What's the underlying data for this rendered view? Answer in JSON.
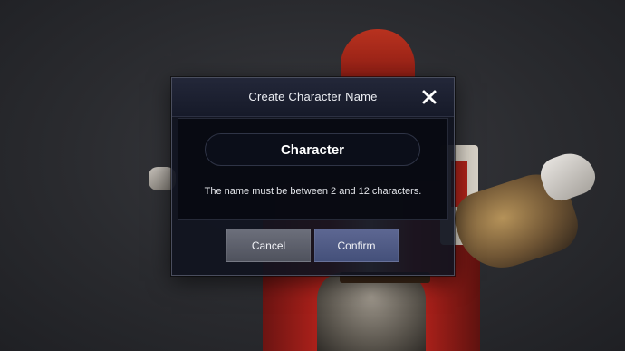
{
  "dialog": {
    "title": "Create Character Name",
    "close_icon": "close-icon",
    "name_input": {
      "value": "Character",
      "placeholder": ""
    },
    "hint": "The name must be between 2 and 12 characters.",
    "cancel_label": "Cancel",
    "confirm_label": "Confirm"
  },
  "colors": {
    "dialog_bg": "#10131f",
    "cancel_button": "#5f626d",
    "confirm_button": "#525d8a",
    "text": "#eceef3"
  }
}
